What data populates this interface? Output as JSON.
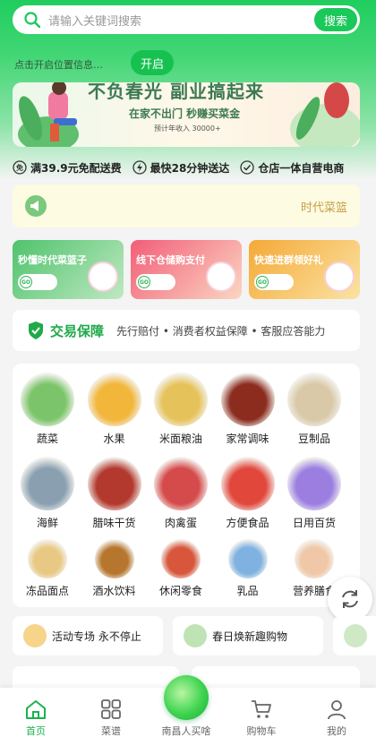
{
  "search": {
    "placeholder": "请输入关键词搜索",
    "button": "搜索"
  },
  "location": {
    "text": "点击开启位置信息…",
    "button": "开启"
  },
  "banner": {
    "title": "不负春光 副业搞起来",
    "subtitle": "在家不出门 秒赚买菜金",
    "note": "预计年收入 30000+"
  },
  "features": [
    "满39.9元免配送费",
    "最快28分钟送达",
    "仓店一体自营电商"
  ],
  "notice": {
    "text": "时代菜篮"
  },
  "promos": [
    {
      "title": "秒懂时代菜篮子",
      "go": "GO",
      "color": "#5cc878"
    },
    {
      "title": "线下仓储购支付",
      "go": "GO",
      "color": "#f46a7d"
    },
    {
      "title": "快速进群领好礼",
      "go": "GO",
      "color": "#f5b340"
    }
  ],
  "guarantee": {
    "title": "交易保障",
    "desc": "先行赔付 • 消费者权益保障 • 客服应答能力"
  },
  "categories": [
    {
      "label": "蔬菜",
      "color": "#7cc46a"
    },
    {
      "label": "水果",
      "color": "#f2b63b"
    },
    {
      "label": "米面粮油",
      "color": "#e6c25a"
    },
    {
      "label": "家常调味",
      "color": "#8b2c1e"
    },
    {
      "label": "豆制品",
      "color": "#d9c9a8"
    },
    {
      "label": "海鲜",
      "color": "#8aa0b0"
    },
    {
      "label": "腊味干货",
      "color": "#b3382d"
    },
    {
      "label": "肉禽蛋",
      "color": "#d54a4a"
    },
    {
      "label": "方便食品",
      "color": "#e2473b"
    },
    {
      "label": "日用百货",
      "color": "#9b7ee0"
    },
    {
      "label": "冻品面点",
      "color": "#e8c984"
    },
    {
      "label": "酒水饮料",
      "color": "#b7762e"
    },
    {
      "label": "休闲零食",
      "color": "#d8573c"
    },
    {
      "label": "乳品",
      "color": "#7fb2e0"
    },
    {
      "label": "营养膳食",
      "color": "#f0c8a8"
    }
  ],
  "activities": [
    {
      "text": "活动专场 永不停止"
    },
    {
      "text": "春日焕新趣购物"
    }
  ],
  "tabs": [
    {
      "label": "首页"
    },
    {
      "label": "菜谱"
    },
    {
      "label": "南昌人买啥"
    },
    {
      "label": "购物车"
    },
    {
      "label": "我的"
    }
  ],
  "colors": {
    "brand": "#1bc85a",
    "active_tab": "#1bb24f",
    "guarantee": "#1faa49",
    "notice_text": "#c7a047"
  }
}
